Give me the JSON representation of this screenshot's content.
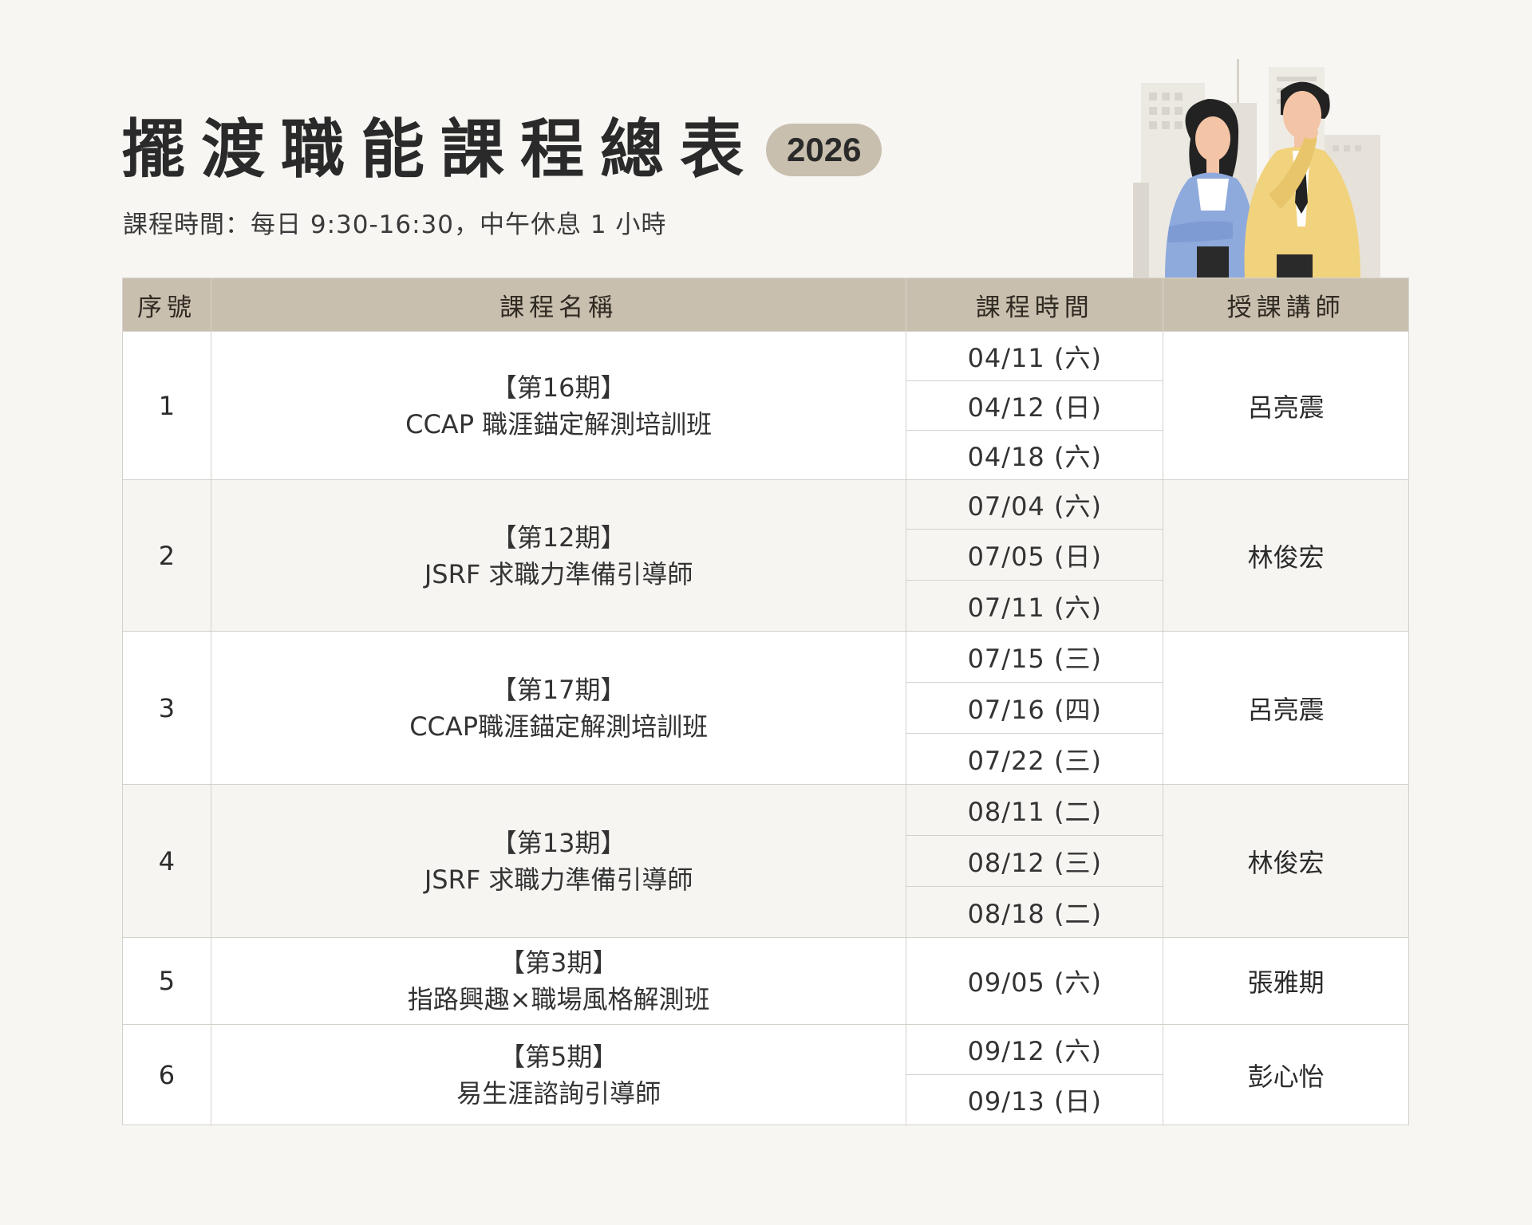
{
  "header": {
    "title": "擺渡職能課程總表",
    "year": "2026",
    "subtitle": "課程時間：每日 9:30-16:30，中午休息 1 小時"
  },
  "table": {
    "headers": [
      "序號",
      "課程名稱",
      "課程時間",
      "授課講師"
    ],
    "rows": [
      {
        "no": "1",
        "period": "【第16期】",
        "name": "CCAP 職涯錨定解測培訓班",
        "dates": [
          "04/11 (六)",
          "04/12 (日)",
          "04/18 (六)"
        ],
        "instructor": "呂亮震"
      },
      {
        "no": "2",
        "period": "【第12期】",
        "name": "JSRF 求職力準備引導師",
        "dates": [
          "07/04 (六)",
          "07/05 (日)",
          "07/11 (六)"
        ],
        "instructor": "林俊宏"
      },
      {
        "no": "3",
        "period": "【第17期】",
        "name": "CCAP職涯錨定解測培訓班",
        "dates": [
          "07/15 (三)",
          "07/16 (四)",
          "07/22 (三)"
        ],
        "instructor": "呂亮震"
      },
      {
        "no": "4",
        "period": "【第13期】",
        "name": "JSRF 求職力準備引導師",
        "dates": [
          "08/11 (二)",
          "08/12 (三)",
          "08/18 (二)"
        ],
        "instructor": "林俊宏"
      },
      {
        "no": "5",
        "period": "【第3期】",
        "name": "指路興趣×職場風格解測班",
        "dates": [
          "09/05 (六)"
        ],
        "instructor": "張雅期"
      },
      {
        "no": "6",
        "period": "【第5期】",
        "name": "易生涯諮詢引導師",
        "dates": [
          "09/12 (六)",
          "09/13 (日)"
        ],
        "instructor": "彭心怡"
      }
    ]
  },
  "colors": {
    "background": "#f7f6f3",
    "header_fill": "#c9bfae",
    "badge_fill": "#c9bfae"
  },
  "illustration": {
    "icon": "business-people-icon"
  }
}
